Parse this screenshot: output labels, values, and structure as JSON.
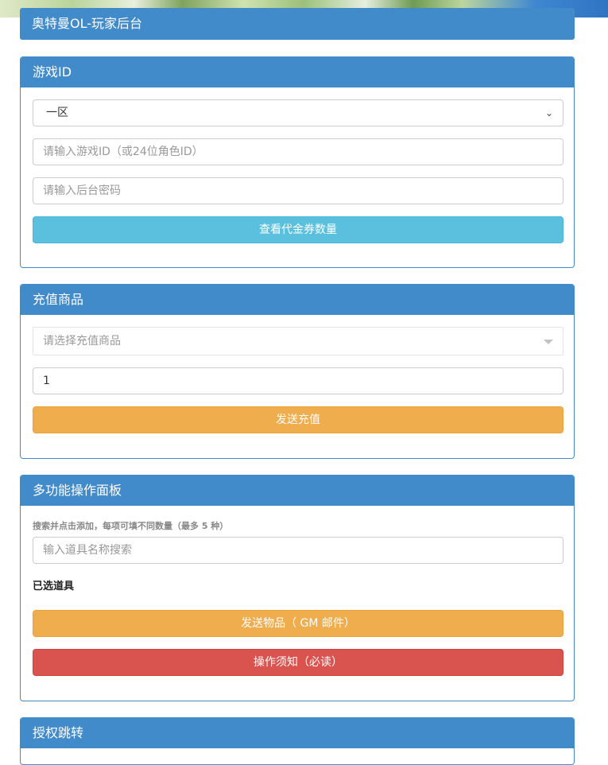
{
  "header": {
    "title": "奥特曼OL-玩家后台"
  },
  "game_id_panel": {
    "title": "游戏ID",
    "zone_select": {
      "value": "一区",
      "options": [
        "一区"
      ]
    },
    "game_id_input": {
      "placeholder": "请输入游戏ID（或24位角色ID）",
      "value": ""
    },
    "password_input": {
      "placeholder": "请输入后台密码",
      "value": ""
    },
    "check_button_label": "查看代金券数量"
  },
  "recharge_panel": {
    "title": "充值商品",
    "product_select": {
      "placeholder": "请选择充值商品"
    },
    "quantity_input": {
      "value": "1"
    },
    "send_button_label": "发送充值"
  },
  "multi_panel": {
    "title": "多功能操作面板",
    "hint": "搜索并点击添加，每项可填不同数量（最多 5 种）",
    "search_input": {
      "placeholder": "输入道具名称搜索",
      "value": ""
    },
    "selected_label": "已选道具",
    "send_items_button_label": "发送物品（ GM 邮件）",
    "notice_button_label": "操作须知（必读）"
  },
  "auth_panel": {
    "title": "授权跳转"
  },
  "colors": {
    "primary": "#428bca",
    "info": "#5bc0de",
    "warning": "#f0ad4e",
    "danger": "#d9534f"
  }
}
